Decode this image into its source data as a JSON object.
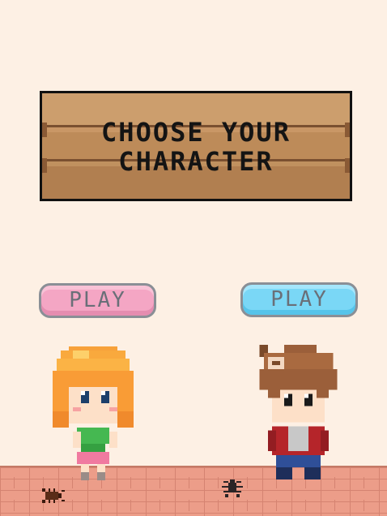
{
  "screen": {
    "title": "CHOOSE YOUR\nCHARACTER"
  },
  "characters": [
    {
      "id": "girl",
      "play_label": "PLAY",
      "button_color": "#f4a6c4"
    },
    {
      "id": "boy",
      "play_label": "PLAY",
      "button_color": "#7ad7f6"
    }
  ],
  "colors": {
    "background": "#fdf0e4",
    "sign_wood": "#c59563",
    "floor_brick": "#ec9d89",
    "label_text": "#6a6f78"
  },
  "icons": [
    "cockroach-icon",
    "spider-icon"
  ]
}
